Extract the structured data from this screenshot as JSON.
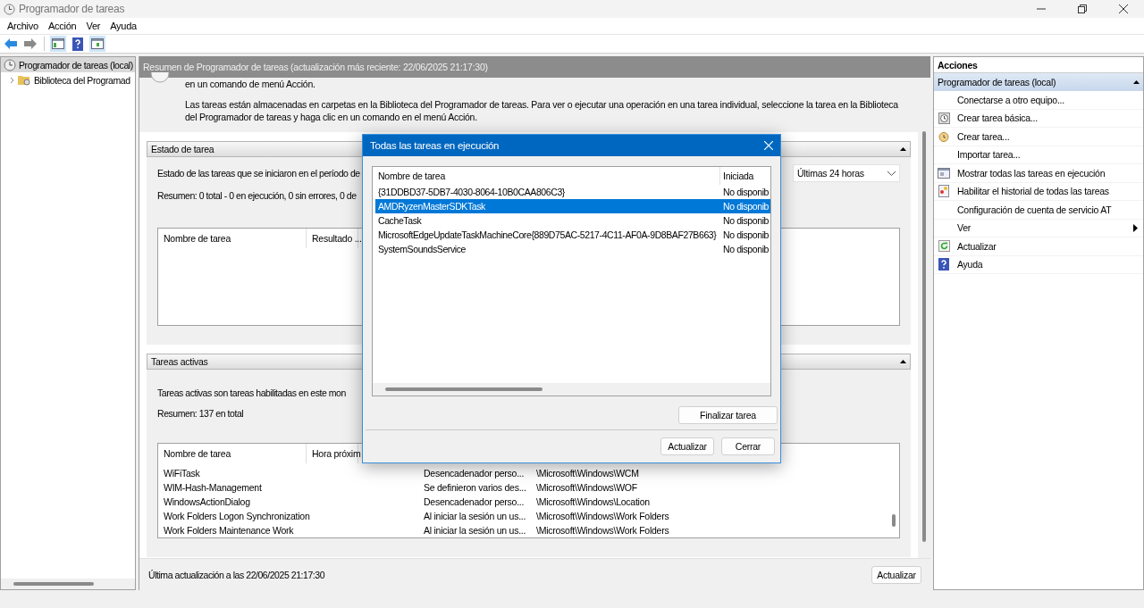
{
  "window": {
    "title": "Programador de tareas"
  },
  "menu": [
    "Archivo",
    "Acción",
    "Ver",
    "Ayuda"
  ],
  "tree": [
    {
      "label": "Programador de tareas (local)",
      "selected": true,
      "children": [
        {
          "label": "Biblioteca del Programad",
          "selected": false
        }
      ]
    }
  ],
  "summary": {
    "header": "Resumen de Programador de tareas (actualización más reciente: 22/06/2025 21:17:30)",
    "intro": [
      "en un comando de menú Acción.",
      "Las tareas están almacenadas en carpetas en la Biblioteca del Programador de tareas. Para ver o ejecutar una operación en una tarea individual, seleccione la tarea en la Biblioteca del Programador de tareas y haga clic en un comando en el menú Acción."
    ]
  },
  "task_status": {
    "title": "Estado de tarea",
    "expanded": true,
    "description": "Estado de las tareas que se iniciaron en el período de",
    "period": "Últimas 24 horas",
    "summary": "Resumen: 0 total - 0 en ejecución, 0 sin errores, 0 de",
    "columns": [
      "Nombre de tarea",
      "Resultado ..."
    ]
  },
  "active_tasks": {
    "title": "Tareas activas",
    "expanded": true,
    "description": "Tareas activas son tareas habilitadas en este mon",
    "summary": "Resumen: 137 en total",
    "columns": [
      "Nombre de tarea",
      "Hora próxim"
    ],
    "rows": [
      {
        "name": "WiFiTask",
        "column_3": "Desencadenador perso...",
        "column_4": "\\Microsoft\\Windows\\WCM"
      },
      {
        "name": "WIM-Hash-Management",
        "column_3": "Se definieron varios des...",
        "column_4": "\\Microsoft\\Windows\\WOF"
      },
      {
        "name": "WindowsActionDialog",
        "column_3": "Desencadenador perso...",
        "column_4": "\\Microsoft\\Windows\\Location"
      },
      {
        "name": "Work Folders Logon Synchronization",
        "column_3": "Al iniciar la sesión un us...",
        "column_4": "\\Microsoft\\Windows\\Work Folders"
      },
      {
        "name": "Work Folders Maintenance Work",
        "column_3": "Al iniciar la sesión un us...",
        "column_4": "\\Microsoft\\Windows\\Work Folders"
      }
    ]
  },
  "status": {
    "text": "Última actualización a las 22/06/2025 21:17:30",
    "button": "Actualizar"
  },
  "actions": {
    "title": "Acciones",
    "group": "Programador de tareas (local)",
    "expanded": true,
    "items": [
      {
        "label": "Conectarse a otro equipo...",
        "kind": "plain"
      },
      {
        "label": "Crear tarea básica...",
        "kind": "basic-task"
      },
      {
        "label": "Crear tarea...",
        "kind": "new-task"
      },
      {
        "label": "Importar tarea...",
        "kind": "plain"
      },
      {
        "label": "Mostrar todas las tareas en ejecución",
        "kind": "running"
      },
      {
        "label": "Habilitar el historial de todas las tareas",
        "kind": "history"
      },
      {
        "label": "Configuración de cuenta de servicio AT",
        "kind": "plain"
      },
      {
        "label": "Ver",
        "kind": "submenu"
      },
      {
        "label": "Actualizar",
        "kind": "refresh"
      },
      {
        "label": "Ayuda",
        "kind": "help"
      }
    ]
  },
  "dialog": {
    "title": "Todas las tareas en ejecución",
    "columns": [
      "Nombre de tarea",
      "Iniciada"
    ],
    "rows": [
      {
        "name": "{31DDBD37-5DB7-4030-8064-10B0CAA806C3}",
        "started": "No disponib",
        "selected": false
      },
      {
        "name": "AMDRyzenMasterSDKTask",
        "started": "No disponib",
        "selected": true
      },
      {
        "name": "CacheTask",
        "started": "No disponib",
        "selected": false
      },
      {
        "name": "MicrosoftEdgeUpdateTaskMachineCore{889D75AC-5217-4C11-AF0A-9D8BAF27B663}",
        "started": "No disponib",
        "selected": false
      },
      {
        "name": "SystemSoundsService",
        "started": "No disponib",
        "selected": false
      }
    ],
    "end_button": "Finalizar tarea",
    "refresh_button": "Actualizar",
    "close_button": "Cerrar"
  }
}
